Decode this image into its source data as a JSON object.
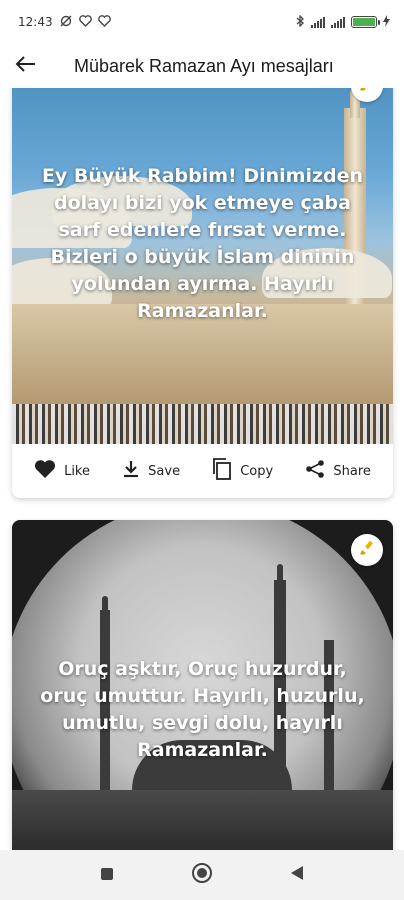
{
  "status_bar": {
    "time": "12:43",
    "battery_label": "100",
    "battery_level": 1.0,
    "icons": [
      "no-disturb-icon",
      "heart-icon",
      "heart-icon",
      "bluetooth-icon",
      "signal-icon",
      "signal-icon",
      "battery-icon",
      "charging-icon"
    ]
  },
  "app_bar": {
    "back_icon": "arrow-left-icon",
    "title": "Mübarek Ramazan Ayı mesajları"
  },
  "cards": [
    {
      "message": "Ey Büyük Rabbim! Dinimizden dolayı bizi yok etmeye çaba sarf edenlere fırsat verme. Bizleri o büyük İslam dininin yolundan ayırma. Hayırlı Ramazanlar.",
      "badge_icon": "paint-brush-icon",
      "actions": {
        "like": "Like",
        "save": "Save",
        "copy": "Copy",
        "share": "Share"
      }
    },
    {
      "message": "Oruç aşktır, Oruç huzurdur, oruç umuttur. Hayırlı, huzurlu, umutlu, sevgi dolu, hayırlı Ramazanlar.",
      "badge_icon": "paint-brush-icon"
    }
  ],
  "nav_bar": {
    "icons": [
      "square-icon",
      "home-circle-icon",
      "back-triangle-icon"
    ]
  }
}
